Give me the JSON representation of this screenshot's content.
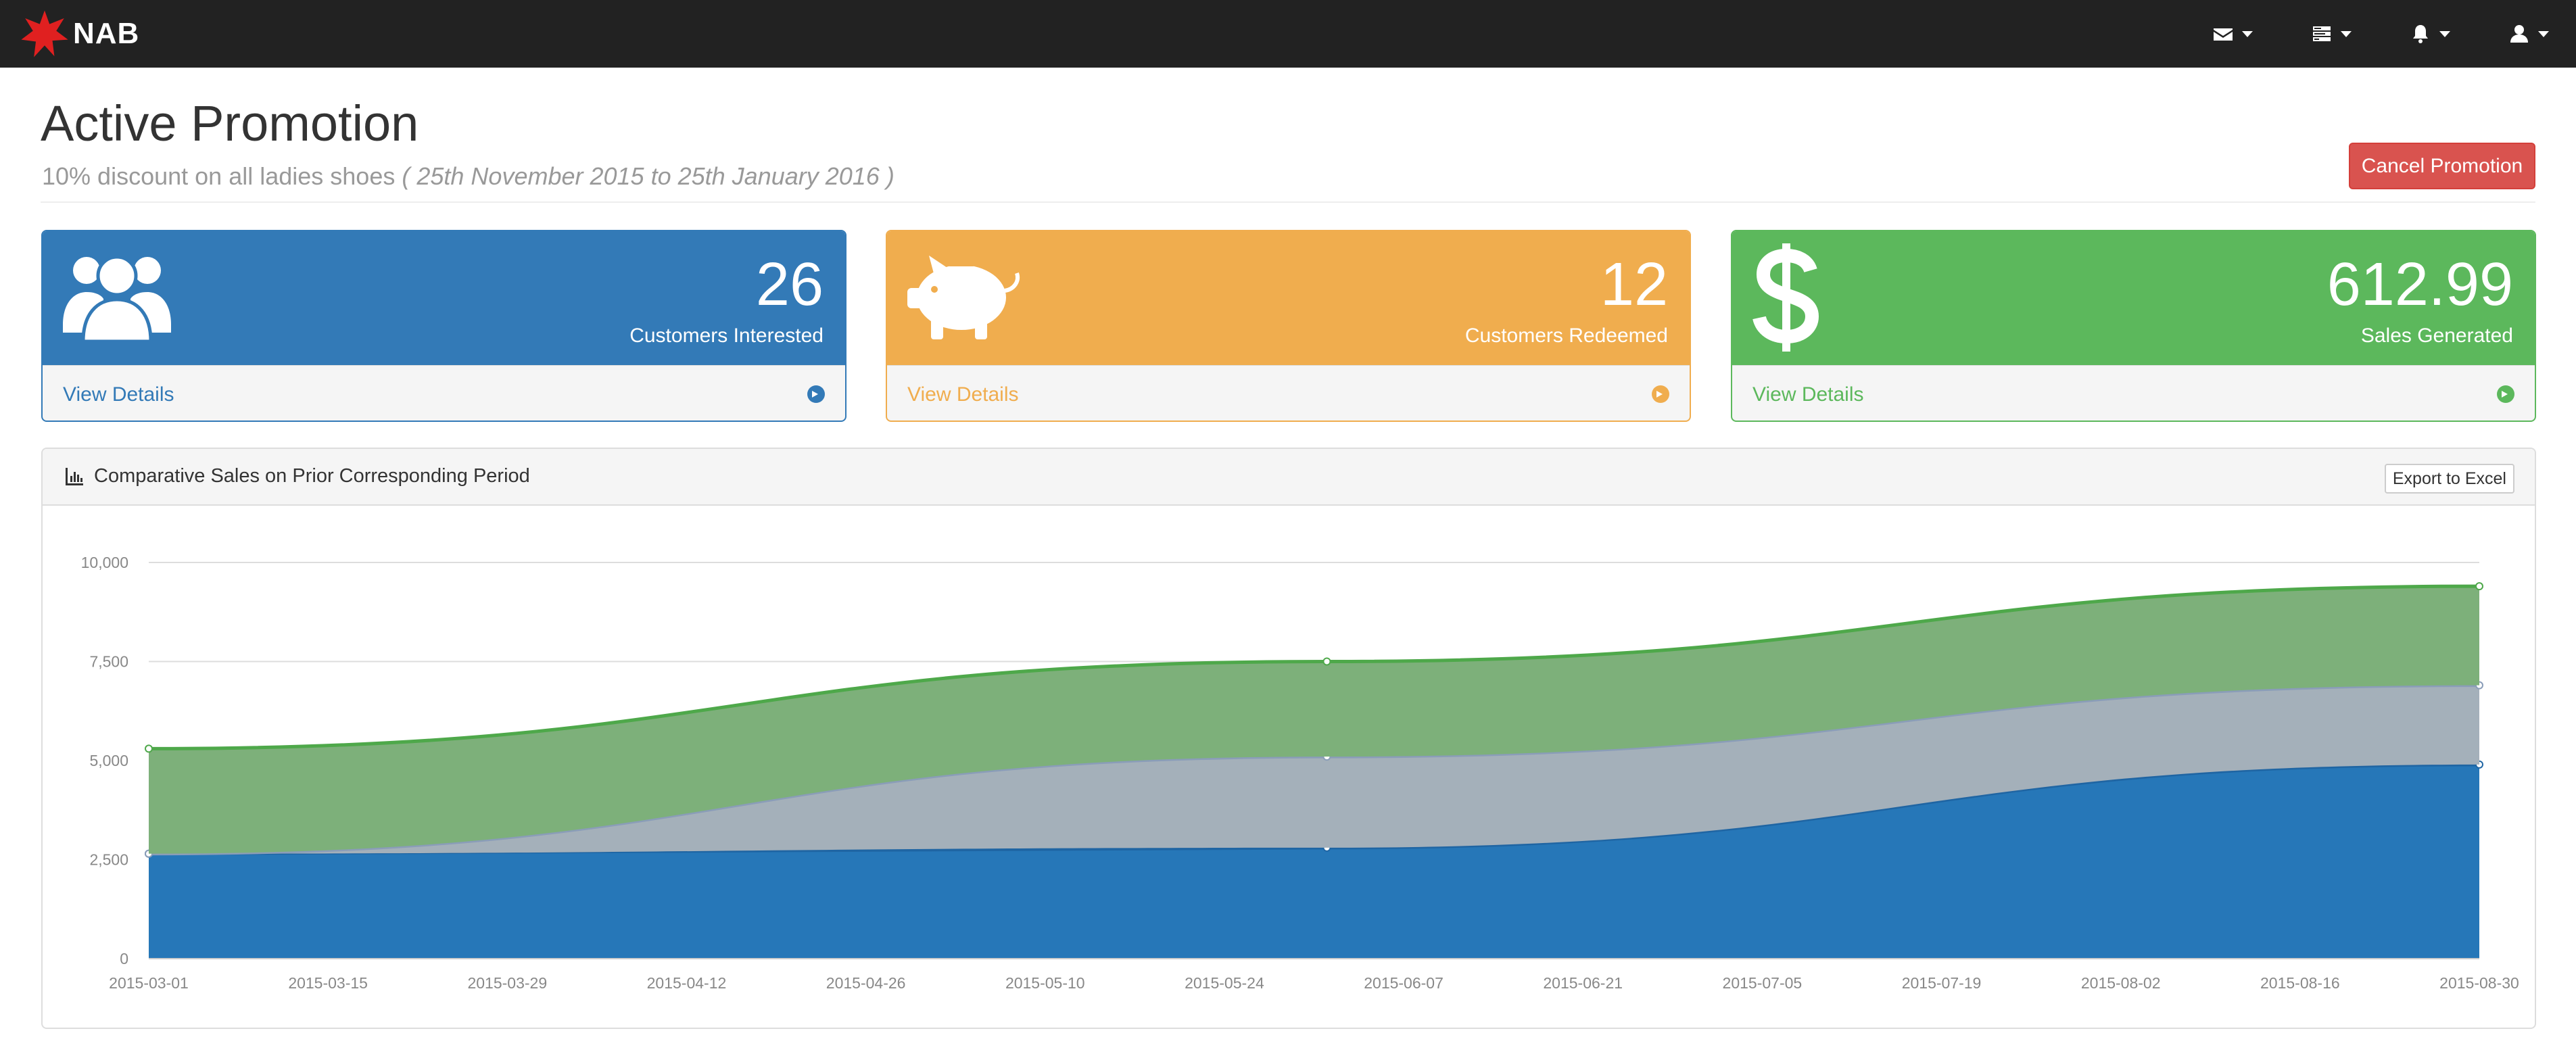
{
  "navbar": {
    "brand": "NAB",
    "icons": [
      "envelope-icon",
      "tasks-icon",
      "bell-icon",
      "user-icon"
    ]
  },
  "header": {
    "title": "Active Promotion",
    "subtitle_main": "10% discount on all ladies shoes",
    "subtitle_dates": "( 25th November 2015 to 25th January 2016 )",
    "cancel_button": "Cancel Promotion"
  },
  "panels": [
    {
      "value": "26",
      "label": "Customers Interested",
      "link": "View Details",
      "color": "#337ab7",
      "icon": "users-icon"
    },
    {
      "value": "12",
      "label": "Customers Redeemed",
      "link": "View Details",
      "color": "#f0ad4e",
      "icon": "piggy-bank-icon"
    },
    {
      "value": "612.99",
      "label": "Sales Generated",
      "link": "View Details",
      "color": "#5cb85c",
      "icon": "dollar-icon"
    }
  ],
  "chart_panel": {
    "title": "Comparative Sales on Prior Corresponding Period",
    "export_button": "Export to Excel"
  },
  "chart_data": {
    "type": "area",
    "stacked": true,
    "x": [
      "2015-03-01",
      "2015-06-01",
      "2015-08-30"
    ],
    "x_tick_labels": [
      "2015-03-01",
      "2015-03-15",
      "2015-03-29",
      "2015-04-12",
      "2015-04-26",
      "2015-05-10",
      "2015-05-24",
      "2015-06-07",
      "2015-06-21",
      "2015-07-05",
      "2015-07-19",
      "2015-08-02",
      "2015-08-16",
      "2015-08-30"
    ],
    "y_ticks": [
      0,
      2500,
      5000,
      7500,
      10000
    ],
    "y_tick_labels": [
      "0",
      "2,500",
      "5,000",
      "7,500",
      "10,000"
    ],
    "ylim": [
      0,
      10000
    ],
    "grid": true,
    "series": [
      {
        "values": [
          2650,
          2800,
          4900
        ],
        "color": "#2677b8"
      },
      {
        "values": [
          0,
          2300,
          2000
        ],
        "color": "#a4b0ba"
      },
      {
        "values": [
          2650,
          2400,
          2500
        ],
        "color": "#7db07a"
      }
    ]
  }
}
